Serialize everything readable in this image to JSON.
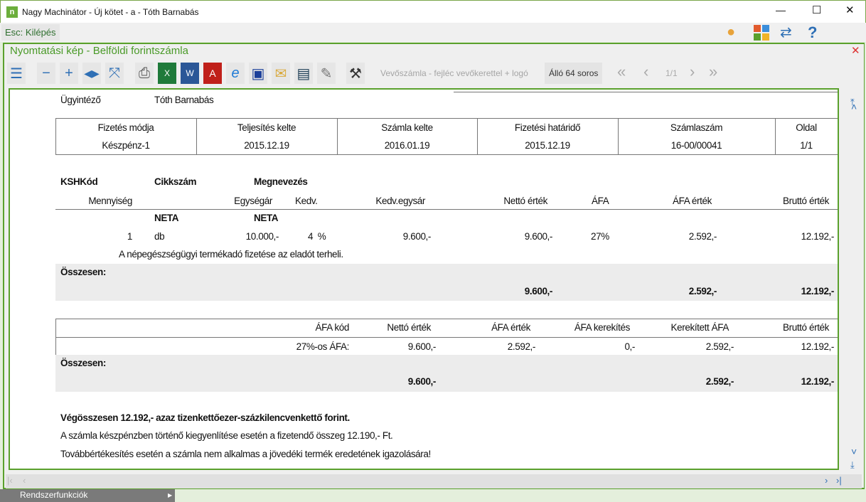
{
  "window": {
    "title": "Nagy Machinátor - Új kötet - a - Tóth Barnabás",
    "minimize": "—",
    "maximize": "☐",
    "close": "✕"
  },
  "esc_label": "Esc: Kilépés",
  "panel_title": "Nyomtatási kép - Belföldi forintszámla",
  "toolbar": {
    "template": "Vevőszámla - fejléc vevőkerettel + logó",
    "layout": "Álló 64 soros",
    "page": "1/1"
  },
  "invoice": {
    "clerk_label": "Ügyintéző",
    "clerk": "Tóth Barnabás",
    "header_cols": [
      {
        "label": "Fizetés módja",
        "value": "Készpénz-1"
      },
      {
        "label": "Teljesítés kelte",
        "value": "2015.12.19"
      },
      {
        "label": "Számla kelte",
        "value": "2016.01.19"
      },
      {
        "label": "Fizetési határidő",
        "value": "2015.12.19"
      },
      {
        "label": "Számlaszám",
        "value": "16-00/00041"
      },
      {
        "label": "Oldal",
        "value": "1/1"
      }
    ],
    "items_head": {
      "ksh": "KSHKód",
      "sku": "Cikkszám",
      "name": "Megnevezés",
      "qty": "Mennyiség",
      "unit_price": "Egységár",
      "disc": "Kedv.",
      "disc_price": "Kedv.egysár",
      "net": "Nettó érték",
      "vat": "ÁFA",
      "vat_value": "ÁFA érték",
      "gross": "Bruttó érték"
    },
    "item": {
      "sku": "NETA",
      "name": "NETA",
      "qty": "1",
      "unit": "db",
      "unit_price": "10.000,-",
      "disc": "4  %",
      "disc_price": "9.600,-",
      "net": "9.600,-",
      "vat": "27%",
      "vat_value": "2.592,-",
      "gross": "12.192,-",
      "note": "A népegészségügyi termékadó fizetése az eladót terheli."
    },
    "total_label": "Összesen:",
    "totals": {
      "net": "9.600,-",
      "vat_value": "2.592,-",
      "gross": "12.192,-"
    },
    "vat_head": {
      "code": "ÁFA kód",
      "net": "Nettó érték",
      "vat": "ÁFA érték",
      "rounding": "ÁFA kerekítés",
      "rounded": "Kerekített ÁFA",
      "gross": "Bruttó érték"
    },
    "vat_row": {
      "code": "27%-os ÁFA:",
      "net": "9.600,-",
      "vat": "2.592,-",
      "rounding": "0,-",
      "rounded": "2.592,-",
      "gross": "12.192,-"
    },
    "vat_totals": {
      "net": "9.600,-",
      "rounded": "2.592,-",
      "gross": "12.192,-"
    },
    "footer": [
      "Végösszesen 12.192,- azaz tizenkettőezer-százkilencvenkettő forint.",
      "A számla készpénzben történő kiegyenlítése esetén a fizetendő összeg 12.190,- Ft.",
      "Továbbértékesítés esetén a számla nem alkalmas a jövedéki termék eredetének igazolására!"
    ]
  },
  "taskbar": {
    "label": "Rendszerfunkciók"
  }
}
